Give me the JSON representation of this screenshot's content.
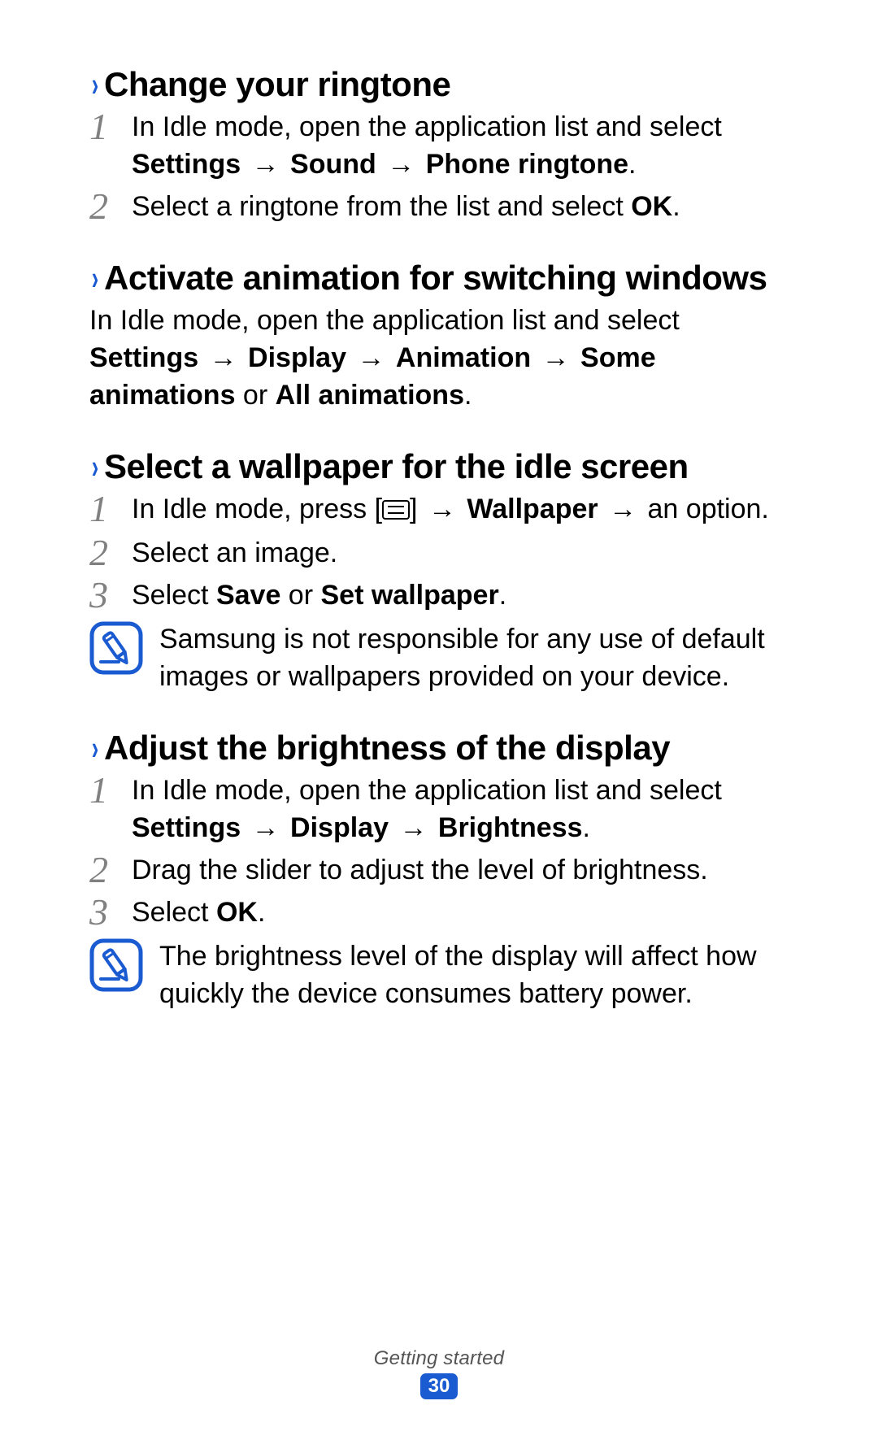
{
  "footer": {
    "section_label": "Getting started",
    "page_number": "30"
  },
  "glyphs": {
    "arrow": "→",
    "chevron": "›"
  },
  "sections": [
    {
      "id": "ringtone",
      "heading": "Change your ringtone",
      "steps": [
        {
          "num": "1",
          "parts": [
            {
              "t": "In Idle mode, open the application list and select "
            },
            {
              "t": "Settings",
              "b": true
            },
            {
              "t": " "
            },
            {
              "arrow": true
            },
            {
              "t": " "
            },
            {
              "t": "Sound",
              "b": true
            },
            {
              "t": " "
            },
            {
              "arrow": true
            },
            {
              "t": " "
            },
            {
              "t": "Phone ringtone",
              "b": true
            },
            {
              "t": "."
            }
          ]
        },
        {
          "num": "2",
          "parts": [
            {
              "t": "Select a ringtone from the list and select "
            },
            {
              "t": "OK",
              "b": true
            },
            {
              "t": "."
            }
          ]
        }
      ]
    },
    {
      "id": "animation",
      "heading": "Activate animation for switching windows",
      "plain": {
        "parts": [
          {
            "t": "In Idle mode, open the application list and select "
          },
          {
            "t": "Settings",
            "b": true
          },
          {
            "t": " "
          },
          {
            "arrow": true
          },
          {
            "t": " "
          },
          {
            "t": "Display",
            "b": true
          },
          {
            "t": " "
          },
          {
            "arrow": true
          },
          {
            "t": " "
          },
          {
            "t": "Animation",
            "b": true
          },
          {
            "t": " "
          },
          {
            "arrow": true
          },
          {
            "t": " "
          },
          {
            "t": "Some animations",
            "b": true
          },
          {
            "t": " or "
          },
          {
            "t": "All animations",
            "b": true
          },
          {
            "t": "."
          }
        ]
      }
    },
    {
      "id": "wallpaper",
      "heading": "Select a wallpaper for the idle screen",
      "steps": [
        {
          "num": "1",
          "parts": [
            {
              "t": "In Idle mode, press ["
            },
            {
              "menu_icon": true
            },
            {
              "t": "] "
            },
            {
              "arrow": true
            },
            {
              "t": " "
            },
            {
              "t": "Wallpaper",
              "b": true
            },
            {
              "t": " "
            },
            {
              "arrow": true
            },
            {
              "t": " an option."
            }
          ]
        },
        {
          "num": "2",
          "parts": [
            {
              "t": "Select an image."
            }
          ]
        },
        {
          "num": "3",
          "parts": [
            {
              "t": "Select "
            },
            {
              "t": "Save",
              "b": true
            },
            {
              "t": " or "
            },
            {
              "t": "Set wallpaper",
              "b": true
            },
            {
              "t": "."
            }
          ]
        }
      ],
      "note": "Samsung is not responsible for any use of default images or wallpapers provided on your device."
    },
    {
      "id": "brightness",
      "heading": "Adjust the brightness of the display",
      "steps": [
        {
          "num": "1",
          "parts": [
            {
              "t": "In Idle mode, open the application list and select "
            },
            {
              "t": "Settings",
              "b": true
            },
            {
              "t": " "
            },
            {
              "arrow": true
            },
            {
              "t": " "
            },
            {
              "t": "Display",
              "b": true
            },
            {
              "t": " "
            },
            {
              "arrow": true
            },
            {
              "t": " "
            },
            {
              "t": "Brightness",
              "b": true
            },
            {
              "t": "."
            }
          ]
        },
        {
          "num": "2",
          "parts": [
            {
              "t": "Drag the slider to adjust the level of brightness."
            }
          ]
        },
        {
          "num": "3",
          "parts": [
            {
              "t": "Select "
            },
            {
              "t": "OK",
              "b": true
            },
            {
              "t": "."
            }
          ]
        }
      ],
      "note": "The brightness level of the display will affect how quickly the device consumes battery power."
    }
  ]
}
